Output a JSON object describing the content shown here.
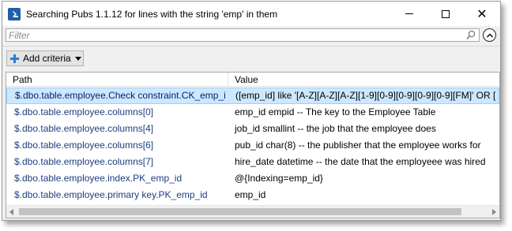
{
  "window": {
    "title": "Searching Pubs 1.1.12 for lines with the string 'emp' in them",
    "close_glyph": "✕"
  },
  "filter": {
    "placeholder": "Filter",
    "value": ""
  },
  "toolbar": {
    "add_criteria_label": "Add criteria"
  },
  "grid": {
    "columns": [
      "Path",
      "Value"
    ],
    "rows": [
      {
        "path": "$.dbo.table.employee.Check constraint.CK_emp_id",
        "value": "([emp_id] like '[A-Z][A-Z][A-Z][1-9][0-9][0-9][0-9][0-9][FM]' OR [",
        "selected": true
      },
      {
        "path": "$.dbo.table.employee.columns[0]",
        "value": "emp_id empid -- The key to the Employee Table",
        "selected": false
      },
      {
        "path": "$.dbo.table.employee.columns[4]",
        "value": "job_id smallint -- the job that the employee does",
        "selected": false
      },
      {
        "path": "$.dbo.table.employee.columns[6]",
        "value": "pub_id char(8) -- the publisher that the employee works for",
        "selected": false
      },
      {
        "path": "$.dbo.table.employee.columns[7]",
        "value": "hire_date datetime -- the date that the employeee was hired",
        "selected": false
      },
      {
        "path": "$.dbo.table.employee.index.PK_emp_id",
        "value": "@{Indexing=emp_id}",
        "selected": false
      },
      {
        "path": "$.dbo.table.employee.primary key.PK_emp_id",
        "value": "emp_id",
        "selected": false
      }
    ]
  },
  "colors": {
    "selection_bg": "#cce8ff",
    "path_text": "#1e3e7e",
    "plus_icon": "#2b7bd1"
  }
}
